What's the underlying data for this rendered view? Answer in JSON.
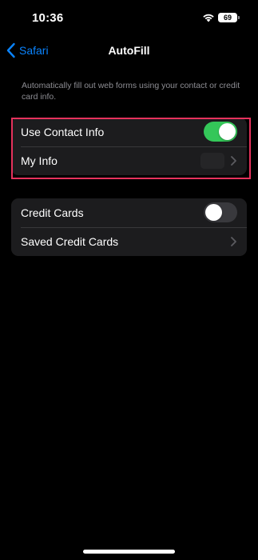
{
  "status_bar": {
    "time": "10:36",
    "battery_level": "69",
    "icons": [
      "wifi-icon",
      "battery-icon"
    ]
  },
  "nav": {
    "back_label": "Safari",
    "back_icon": "chevron-left-icon",
    "title": "AutoFill"
  },
  "description": "Automatically fill out web forms using your contact or credit card info.",
  "contact_group": {
    "use_contact_info": {
      "label": "Use Contact Info",
      "toggle_on": true
    },
    "my_info": {
      "label": "My Info",
      "icon": "chevron-right-icon"
    }
  },
  "credit_group": {
    "credit_cards": {
      "label": "Credit Cards",
      "toggle_on": false
    },
    "saved_credit_cards": {
      "label": "Saved Credit Cards",
      "icon": "chevron-right-icon"
    }
  },
  "colors": {
    "accent": "#0a84ff",
    "toggle_on": "#34c759",
    "highlight": "#e5325c",
    "cell_background": "#1c1c1e"
  }
}
